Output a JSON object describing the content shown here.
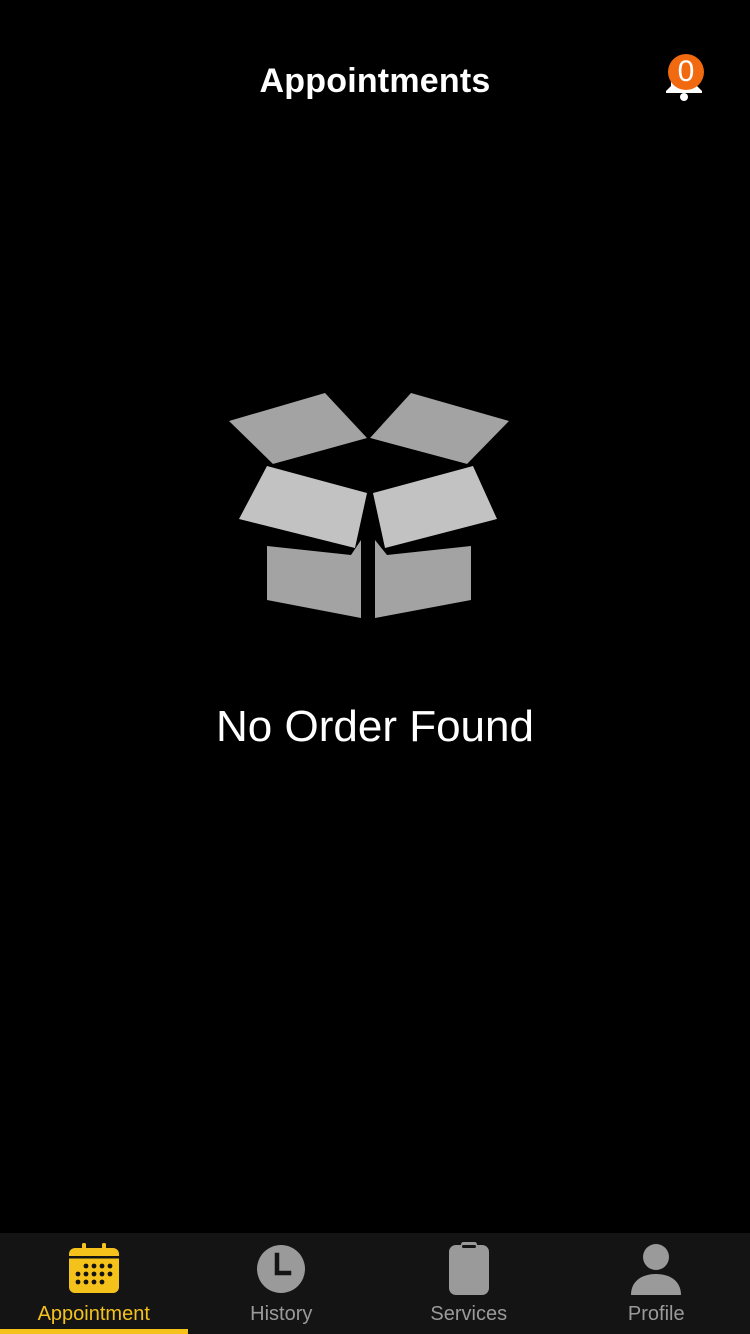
{
  "header": {
    "title": "Appointments",
    "notification_icon": "bell-icon",
    "notification_count": "0"
  },
  "empty_state": {
    "icon": "open-box-icon",
    "message": "No Order Found"
  },
  "bottom_nav": {
    "items": [
      {
        "label": "Appointment",
        "icon": "calendar-icon",
        "active": true
      },
      {
        "label": "History",
        "icon": "clock-icon",
        "active": false
      },
      {
        "label": "Services",
        "icon": "clipboard-icon",
        "active": false
      },
      {
        "label": "Profile",
        "icon": "person-icon",
        "active": false
      }
    ]
  },
  "colors": {
    "background": "#000000",
    "accent": "#f5c21b",
    "badge": "#f26a10",
    "nav_background": "#141414",
    "inactive": "#9a9a9a"
  }
}
